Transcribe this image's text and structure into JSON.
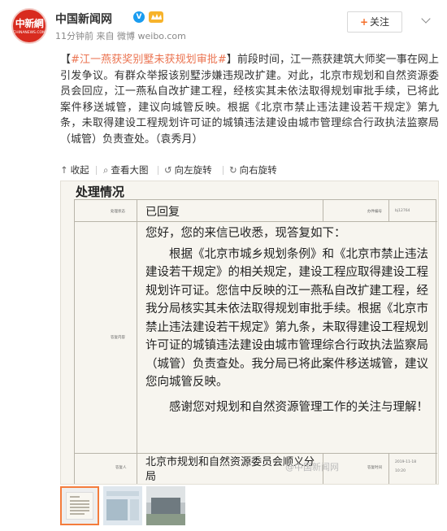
{
  "post": {
    "author": "中国新闻网",
    "verified_badge": "V",
    "time": "11分钟前",
    "source": "来自 微博 weibo.com",
    "follow_label": "关注",
    "avatar_text_cn": "中新網",
    "avatar_text_en": "CHINANEWS.COM",
    "bracket_open": "【",
    "hashtag": "#江一燕获奖别墅未获规划审批#",
    "bracket_close": "】",
    "body": "前段时间，江一燕获建筑大师奖一事在网上引发争议。有群众举报该别墅涉嫌违规改扩建。对此，北京市规划和自然资源委员会回应，江一燕私自改扩建工程，经核实其未依法取得规划审批手续，已将此案件移送城管，建议向城管反映。根据《北京市禁止违法建设若干规定》第九条，未取得建设工程规划许可证的城镇违法建设由城市管理综合行政执法监察局（城管）负责查处。（袁秀月）"
  },
  "toolbar": {
    "collapse": "收起",
    "view_large": "查看大图",
    "rotate_left": "向左旋转",
    "rotate_right": "向右旋转"
  },
  "document": {
    "section_title": "处理情况",
    "status_label": "处理状态",
    "status_value": "已回复",
    "doc_no_label": "办件编号",
    "doc_no_value": "bj12764",
    "reply_label": "答复内容",
    "reply": {
      "greeting": "您好，您的来信已收悉，现答复如下：",
      "paragraph1": "根据《北京市城乡规划条例》和《北京市禁止违法建设若干规定》的相关规定，建设工程应取得建设工程规划许可证。您信中反映的江一燕私自改扩建工程，经我分局核实其未依法取得规划审批手续。根据《北京市禁止违法建设若干规定》第九条，未取得建设工程规划许可证的城镇违法建设由城市管理综合行政执法监察局（城管）负责查处。我分局已将此案件移送城管，建议您向城管反映。",
      "paragraph2": "感谢您对规划和自然资源管理工作的关注与理解！"
    },
    "replier_label": "答复人",
    "replier_value": "北京市规划和自然资源委员会顺义分局",
    "reply_time_label": "答复时间",
    "reply_time_date": "2019-11-18",
    "reply_time_clock": "10:20",
    "watermark": "@中国新闻网"
  },
  "icons": {
    "avatar": "chinanews-logo",
    "level": "vip-level-icon",
    "collapse": "collapse-arrow-icon",
    "view_large": "magnifier-icon",
    "rotate_left": "rotate-left-icon",
    "rotate_right": "rotate-right-icon",
    "menu": "chevron-down-icon"
  },
  "colors": {
    "hashtag": "#eb7350",
    "follow_plus": "#f46f2a",
    "thumb_active_border": "#f47c3c",
    "verified": "#1a9cf0"
  }
}
